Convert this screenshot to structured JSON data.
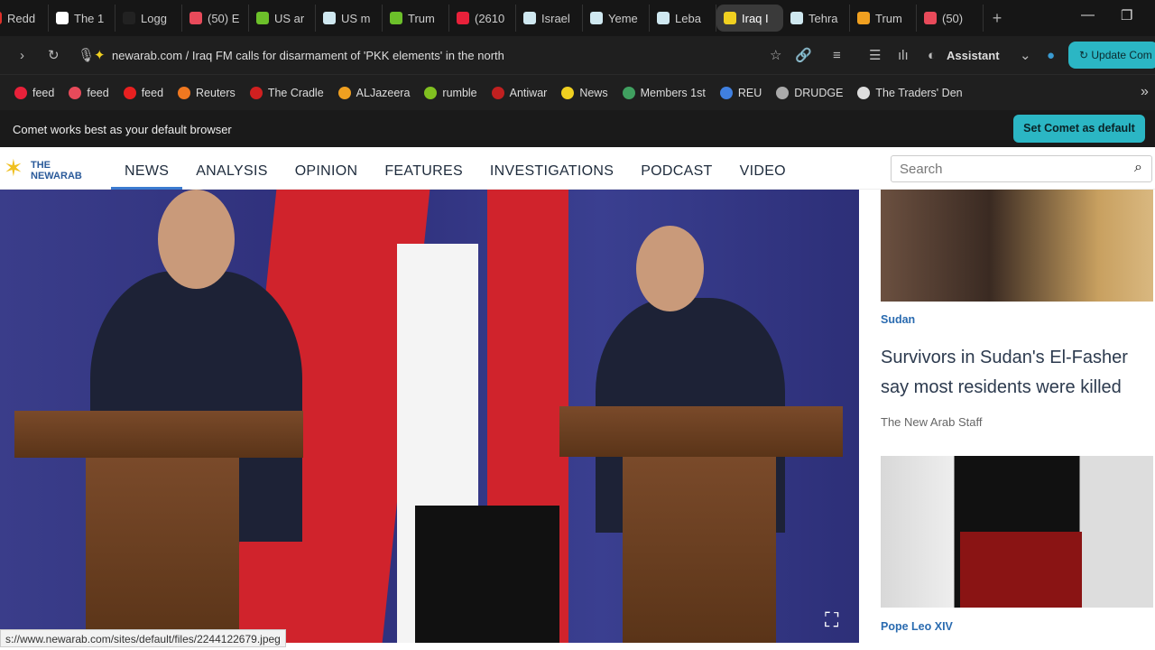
{
  "tabs": [
    {
      "label": "Redd",
      "color": "#e0302a"
    },
    {
      "label": "The 1",
      "color": "#fff"
    },
    {
      "label": "Logg",
      "color": "#222"
    },
    {
      "label": "(50) E",
      "color": "#e84a5a"
    },
    {
      "label": "US ar",
      "color": "#6cc02a"
    },
    {
      "label": "US m",
      "color": "#cfe8f0"
    },
    {
      "label": "Trum",
      "color": "#6cc02a"
    },
    {
      "label": "(2610",
      "color": "#e8213a"
    },
    {
      "label": "Israel",
      "color": "#cfe8f0"
    },
    {
      "label": "Yeme",
      "color": "#cfe8f0"
    },
    {
      "label": "Leba",
      "color": "#cfe8f0"
    },
    {
      "label": "Iraq I",
      "color": "#f0d020",
      "active": true
    },
    {
      "label": "Tehra",
      "color": "#cfe8f0"
    },
    {
      "label": "Trum",
      "color": "#f0a020"
    },
    {
      "label": "(50)",
      "color": "#e84a5a"
    }
  ],
  "address": {
    "url": "newarab.com / Iraq FM calls for disarmament of 'PKK elements' in the north",
    "assistant": "Assistant",
    "update": "Update Com"
  },
  "bookmarks": [
    {
      "label": "feed",
      "color": "#e8213a"
    },
    {
      "label": "feed",
      "color": "#e84a5a"
    },
    {
      "label": "feed",
      "color": "#e82020"
    },
    {
      "label": "Reuters",
      "color": "#f07820"
    },
    {
      "label": "The Cradle",
      "color": "#d02020"
    },
    {
      "label": "ALJazeera",
      "color": "#f0a020"
    },
    {
      "label": "rumble",
      "color": "#80c020"
    },
    {
      "label": "Antiwar",
      "color": "#c02020"
    },
    {
      "label": "News",
      "color": "#f0d020"
    },
    {
      "label": "Members 1st",
      "color": "#40a060"
    },
    {
      "label": "REU",
      "color": "#4080e0"
    },
    {
      "label": "DRUDGE",
      "color": "#aaa"
    },
    {
      "label": "The Traders' Den",
      "color": "#ddd"
    }
  ],
  "infobar": {
    "message": "Comet works best as your default browser",
    "button": "Set Comet as default"
  },
  "site": {
    "logo_line1": "THE",
    "logo_line2": "NEWARAB",
    "nav": [
      "NEWS",
      "ANALYSIS",
      "OPINION",
      "FEATURES",
      "INVESTIGATIONS",
      "PODCAST",
      "VIDEO"
    ],
    "search_placeholder": "Search"
  },
  "sidebar": {
    "story1": {
      "tag": "Sudan",
      "headline": "Survivors in Sudan's El-Fasher say most residents were killed",
      "byline": "The New Arab Staff"
    },
    "story2": {
      "tag": "Pope Leo XIV"
    }
  },
  "status_url": "s://www.newarab.com/sites/default/files/2244122679.jpeg"
}
